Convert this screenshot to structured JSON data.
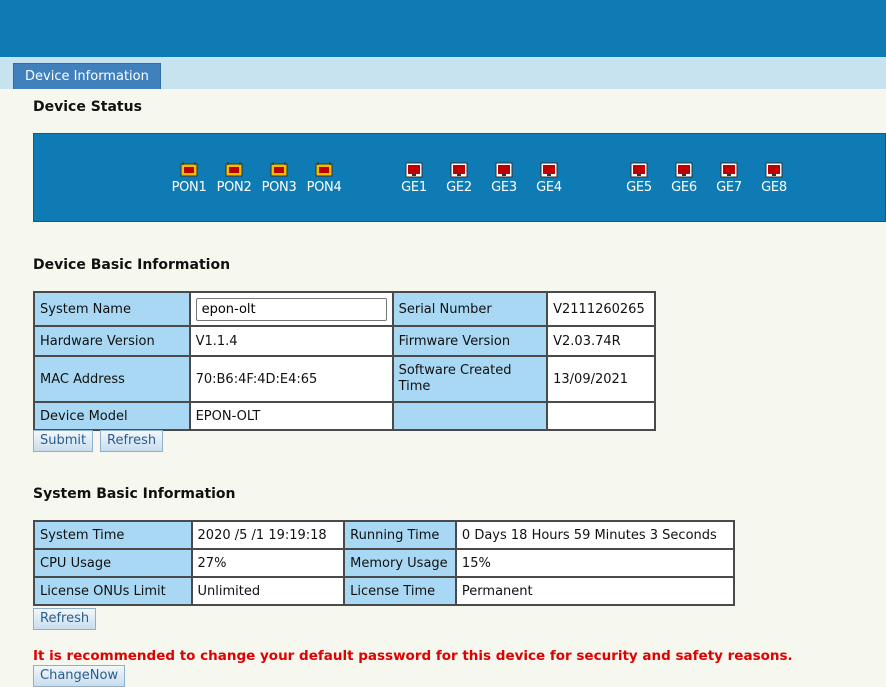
{
  "tab": {
    "label": "Device Information"
  },
  "device_status": {
    "title": "Device Status",
    "pon_ports": [
      "PON1",
      "PON2",
      "PON3",
      "PON4"
    ],
    "ge_ports_a": [
      "GE1",
      "GE2",
      "GE3",
      "GE4"
    ],
    "ge_ports_b": [
      "GE5",
      "GE6",
      "GE7",
      "GE8"
    ]
  },
  "device_basic": {
    "title": "Device Basic Information",
    "system_name_label": "System Name",
    "system_name_value": "epon-olt",
    "serial_number_label": "Serial Number",
    "serial_number_value": "V2111260265",
    "hardware_version_label": "Hardware Version",
    "hardware_version_value": "V1.1.4",
    "firmware_version_label": "Firmware Version",
    "firmware_version_value": "V2.03.74R",
    "mac_address_label": "MAC Address",
    "mac_address_value": "70:B6:4F:4D:E4:65",
    "software_created_label": "Software Created Time",
    "software_created_value": "13/09/2021",
    "device_model_label": "Device Model",
    "device_model_value": "EPON-OLT",
    "submit_label": "Submit",
    "refresh_label": "Refresh"
  },
  "system_basic": {
    "title": "System Basic Information",
    "system_time_label": "System Time",
    "system_time_value": "2020 /5 /1 19:19:18",
    "running_time_label": "Running Time",
    "running_time_value": "0 Days 18 Hours 59 Minutes 3 Seconds",
    "cpu_usage_label": "CPU Usage",
    "cpu_usage_value": "27%",
    "memory_usage_label": "Memory Usage",
    "memory_usage_value": "15%",
    "license_onus_label": "License ONUs Limit",
    "license_onus_value": "Unlimited",
    "license_time_label": "License Time",
    "license_time_value": "Permanent",
    "refresh_label": "Refresh"
  },
  "warning": {
    "text": "It is recommended to change your default password for this device for security and safety reasons.",
    "button_label": "ChangeNow"
  },
  "colors": {
    "header_blue": "#0f7bb5",
    "cell_header": "#a8d8f3",
    "warning_red": "#e00000"
  }
}
